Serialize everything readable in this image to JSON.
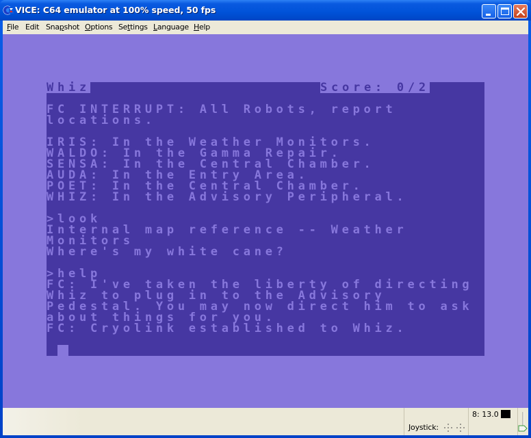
{
  "window": {
    "title": "VICE: C64 emulator at 100% speed, 50 fps",
    "app_icon": "commodore-logo-icon",
    "controls": [
      "minimize",
      "maximize",
      "close"
    ]
  },
  "menu": {
    "items": [
      {
        "label_pre": "",
        "accel": "F",
        "label_post": "ile"
      },
      {
        "label_pre": "",
        "accel": "E",
        "label_post": "dit"
      },
      {
        "label_pre": "Sna",
        "accel": "p",
        "label_post": "shot"
      },
      {
        "label_pre": "",
        "accel": "O",
        "label_post": "ptions"
      },
      {
        "label_pre": "Se",
        "accel": "t",
        "label_post": "tings"
      },
      {
        "label_pre": "",
        "accel": "L",
        "label_post": "anguage"
      },
      {
        "label_pre": "",
        "accel": "H",
        "label_post": "elp"
      }
    ]
  },
  "c64": {
    "colors": {
      "border": "#8777dc",
      "background": "#4637a2",
      "text": "#8777dc"
    },
    "status_line": {
      "location": "Whiz",
      "score": "Score: 0/2"
    },
    "lines": [
      "FC INTERRUPT: All Robots, report",
      "locations.",
      "",
      "IRIS: In the Weather Monitors.",
      "WALDO: In the Gamma Repair.",
      "SENSA: In the Central Chamber.",
      "AUDA: In the Entry Area.",
      "POET: In the Central Chamber.",
      "WHIZ: In the Advisory Peripheral.",
      "",
      ">look",
      "Internal map reference -- Weather",
      "Monitors",
      "Where's my white cane?",
      "",
      ">help",
      "FC: I've taken the liberty of directing",
      "Whiz to plug in to the Advisory",
      "Pedestal. You may now direct him to ask",
      "about things for you.",
      "FC: Cryolink established to Whiz.",
      ""
    ],
    "prompt": ">"
  },
  "statusbar": {
    "joystick_label": "Joystick:",
    "drive_status": "8: 13.0"
  }
}
